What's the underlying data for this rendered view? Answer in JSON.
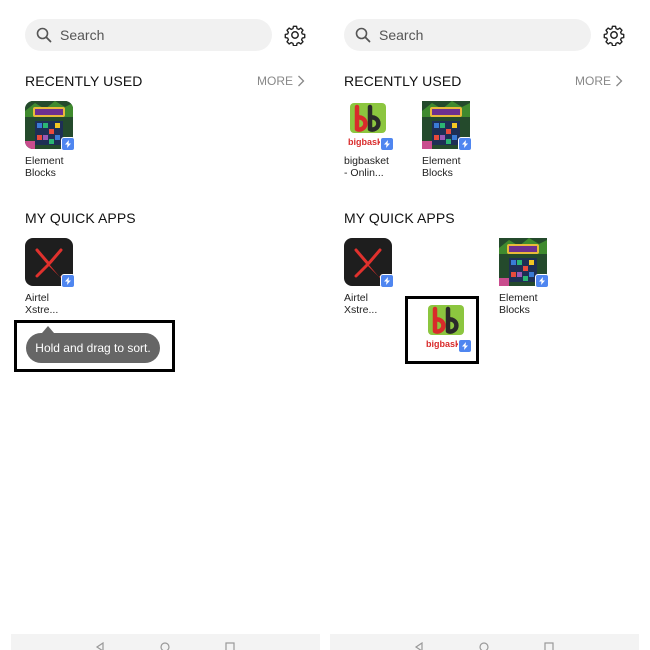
{
  "left": {
    "search": {
      "placeholder": "Search"
    },
    "recent": {
      "title": "RECENTLY USED",
      "more": "MORE"
    },
    "recent_apps": [
      {
        "name": "Element Blocks",
        "label": "Element\nBlocks",
        "icon": "element-blocks-icon"
      }
    ],
    "quick": {
      "title": "MY QUICK APPS"
    },
    "quick_apps": [
      {
        "name": "Airtel Xstream",
        "label": "Airtel\nXstre...",
        "icon": "airtel-xstream-icon"
      }
    ],
    "tooltip": "Hold and drag to sort."
  },
  "right": {
    "search": {
      "placeholder": "Search"
    },
    "recent": {
      "title": "RECENTLY USED",
      "more": "MORE"
    },
    "recent_apps": [
      {
        "name": "bigbasket",
        "label": "bigbasket\n- Onlin...",
        "icon": "bigbasket-icon"
      },
      {
        "name": "Element Blocks",
        "label": "Element\nBlocks",
        "icon": "element-blocks-icon"
      }
    ],
    "quick": {
      "title": "MY QUICK APPS"
    },
    "quick_apps": [
      {
        "name": "Airtel Xstream",
        "label": "Airtel\nXstre...",
        "icon": "airtel-xstream-icon"
      },
      {
        "name": "Element Blocks",
        "label": "Element\nBlocks",
        "icon": "element-blocks-icon"
      }
    ],
    "dragging_app": {
      "name": "bigbasket",
      "icon": "bigbasket-icon",
      "brand_text": "bigbask"
    }
  },
  "brand": {
    "bigbasket_red": "#d92b2b",
    "bigbasket_green": "#8cc63f",
    "airtel_red": "#e0312d",
    "badge_blue": "#4f86f0",
    "tooltip_gray": "#666666"
  }
}
